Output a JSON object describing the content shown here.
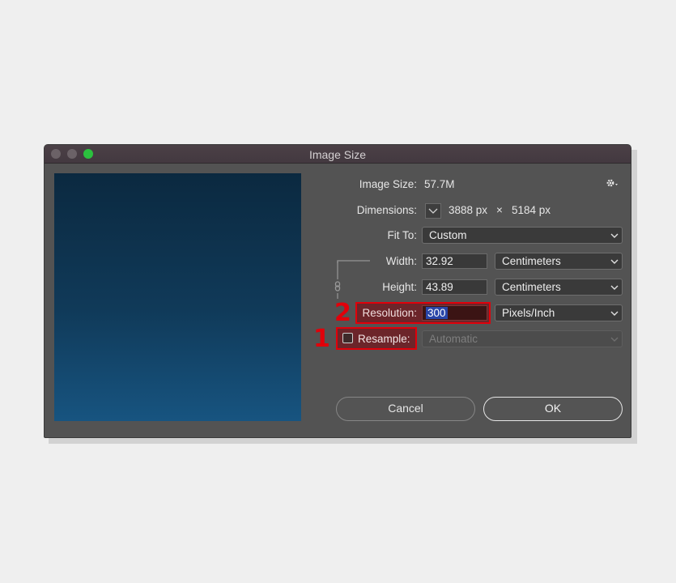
{
  "window": {
    "title": "Image Size"
  },
  "info": {
    "image_size_label": "Image Size:",
    "image_size_value": "57.7M",
    "dimensions_label": "Dimensions:",
    "dim_width": "3888 px",
    "dim_times": "×",
    "dim_height": "5184 px"
  },
  "fit_to": {
    "label": "Fit To:",
    "value": "Custom"
  },
  "width": {
    "label": "Width:",
    "value": "32.92",
    "unit": "Centimeters"
  },
  "height": {
    "label": "Height:",
    "value": "43.89",
    "unit": "Centimeters"
  },
  "resolution": {
    "label": "Resolution:",
    "value": "300",
    "unit": "Pixels/Inch"
  },
  "resample": {
    "label": "Resample:",
    "checked": false,
    "method": "Automatic"
  },
  "buttons": {
    "cancel": "Cancel",
    "ok": "OK"
  },
  "annotations": {
    "one": "1",
    "two": "2"
  },
  "icons": {
    "gear": "gear-icon",
    "link": "link-icon",
    "chevron": "chevron-down-icon"
  },
  "colors": {
    "annotation_red": "#e0000a",
    "zoom_button": "#2bc13e",
    "selection": "#2945a8"
  }
}
